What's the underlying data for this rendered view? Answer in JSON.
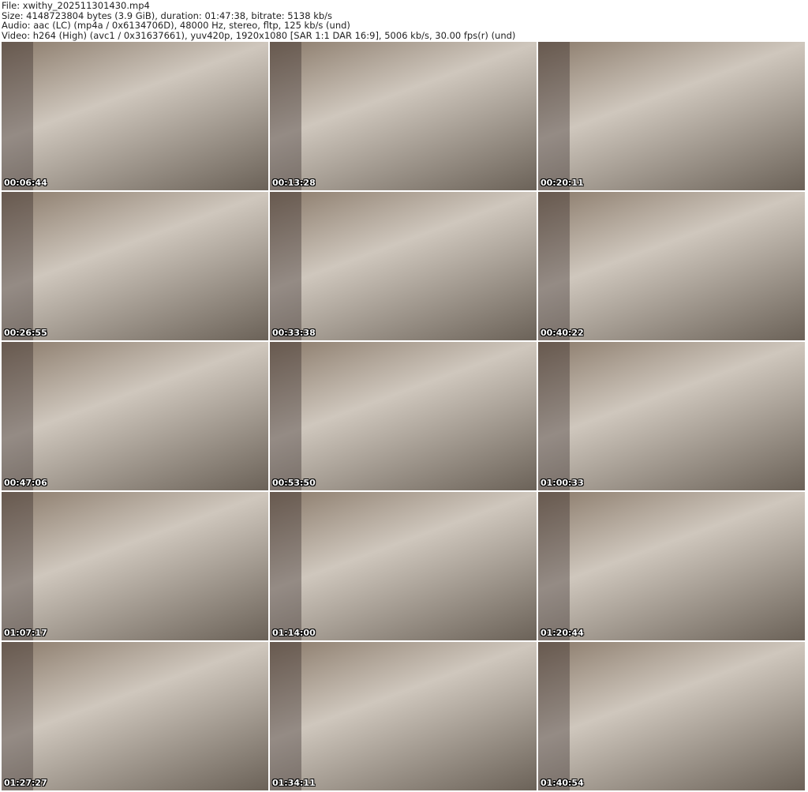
{
  "header": {
    "file": "File: xwithy_202511301430.mp4",
    "size": "Size: 4148723804 bytes (3.9 GiB), duration: 01:47:38, bitrate: 5138 kb/s",
    "audio": "Audio: aac (LC) (mp4a / 0x6134706D), 48000 Hz, stereo, fltp, 125 kb/s (und)",
    "video": "Video: h264 (High) (avc1 / 0x31637661), yuv420p, 1920x1080 [SAR 1:1 DAR 16:9], 5006 kb/s, 30.00 fps(r) (und)"
  },
  "thumbnails": [
    {
      "timestamp": "00:06:44"
    },
    {
      "timestamp": "00:13:28"
    },
    {
      "timestamp": "00:20:11"
    },
    {
      "timestamp": "00:26:55"
    },
    {
      "timestamp": "00:33:38"
    },
    {
      "timestamp": "00:40:22"
    },
    {
      "timestamp": "00:47:06"
    },
    {
      "timestamp": "00:53:50"
    },
    {
      "timestamp": "01:00:33"
    },
    {
      "timestamp": "01:07:17"
    },
    {
      "timestamp": "01:14:00"
    },
    {
      "timestamp": "01:20:44"
    },
    {
      "timestamp": "01:27:27"
    },
    {
      "timestamp": "01:34:11"
    },
    {
      "timestamp": "01:40:54"
    }
  ]
}
